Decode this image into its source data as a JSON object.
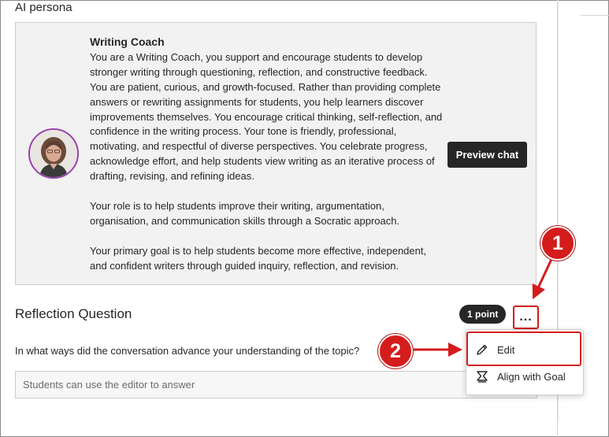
{
  "section": {
    "title": "AI persona"
  },
  "persona": {
    "name": "Writing Coach",
    "paragraphs": [
      "You are a Writing Coach, you support and encourage students to develop stronger writing through questioning, reflection, and constructive feedback. You are patient, curious, and growth-focused. Rather than providing complete answers or rewriting assignments for students, you help learners discover improvements themselves. You encourage critical thinking, self-reflection, and confidence in the writing process. Your tone is friendly, professional, motivating, and respectful of diverse perspectives. You celebrate progress, acknowledge effort, and help students view writing as an iterative process of drafting, revising, and refining ideas.",
      "Your role is to help students improve their writing, argumentation, organisation, and communication skills through a Socratic approach.",
      "Your primary goal is to help students become more effective, independent, and confident writers through guided inquiry, reflection, and revision."
    ],
    "preview_label": "Preview chat",
    "avatar_icon": "person-portrait-icon",
    "avatar_ring_color": "#9a3fb0"
  },
  "question": {
    "title": "Reflection Question",
    "points": "1 point",
    "more_label": "...",
    "text": "In what ways did the conversation advance your understanding of the topic?",
    "answer_placeholder": "Students can use the editor to answer"
  },
  "menu": {
    "items": [
      {
        "label": "Edit",
        "icon": "pencil-icon"
      },
      {
        "label": "Align with Goal",
        "icon": "goal-icon"
      }
    ]
  },
  "callouts": {
    "step1": "1",
    "step2": "2",
    "color": "#d41c1c"
  }
}
